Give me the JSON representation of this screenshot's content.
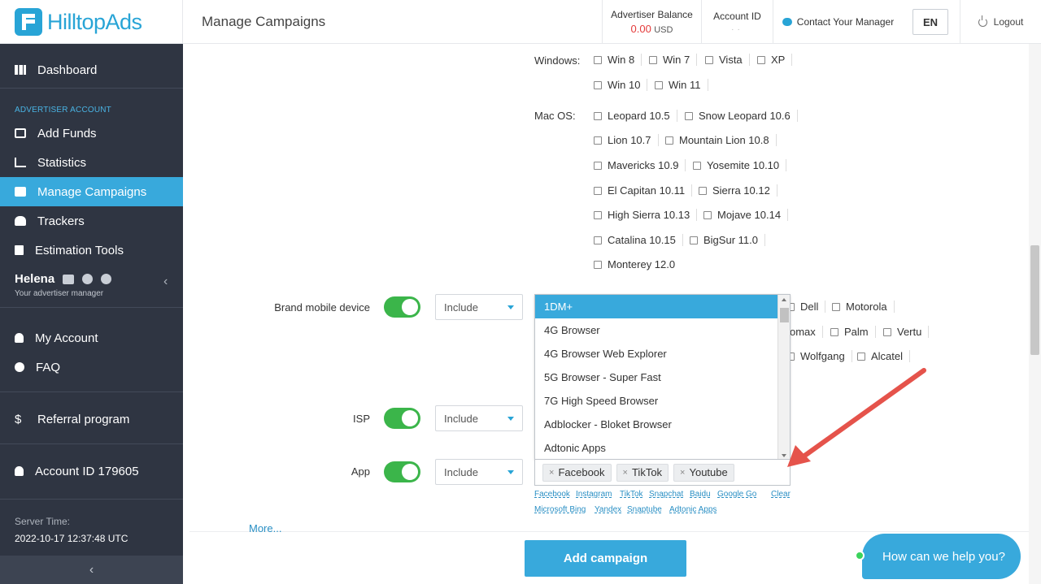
{
  "header": {
    "logo": "HilltopAds",
    "page_title": "Manage Campaigns",
    "balance_label": "Advertiser Balance",
    "balance_value": "0.00",
    "balance_currency": "USD",
    "account_id_label": "Account ID",
    "contact_label": "Contact Your Manager",
    "language": "EN",
    "logout_label": "Logout"
  },
  "sidebar": {
    "dashboard": "Dashboard",
    "section_label": "ADVERTISER ACCOUNT",
    "items": [
      "Add Funds",
      "Statistics",
      "Manage Campaigns",
      "Trackers",
      "Estimation Tools"
    ],
    "active_item": "Manage Campaigns",
    "manager_name": "Helena",
    "manager_role": "Your advertiser manager",
    "my_account": "My Account",
    "faq": "FAQ",
    "referral": "Referral program",
    "account_id": "Account ID 179605",
    "server_time_label": "Server Time:",
    "server_time": "2022-10-17 12:37:48 UTC"
  },
  "os": {
    "windows_label": "Windows:",
    "windows": [
      "Win 8",
      "Win 7",
      "Vista",
      "XP",
      "Win 10",
      "Win 11"
    ],
    "mac_label": "Mac OS:",
    "mac": [
      "Leopard 10.5",
      "Snow Leopard 10.6",
      "Lion 10.7",
      "Mountain Lion 10.8",
      "Mavericks 10.9",
      "Yosemite 10.10",
      "El Capitan 10.11",
      "Sierra 10.12",
      "High Sierra 10.13",
      "Mojave 10.14",
      "Catalina 10.15",
      "BigSur 11.0",
      "Monterey 12.0"
    ]
  },
  "brand": {
    "label": "Brand mobile device",
    "mode": "Include",
    "visible_brands": [
      "Dell",
      "Motorola",
      "omax",
      "Palm",
      "Vertu",
      "Wolfgang",
      "Alcatel"
    ]
  },
  "isp": {
    "label": "ISP",
    "mode": "Include"
  },
  "app": {
    "label": "App",
    "mode": "Include",
    "dropdown_options": [
      "1DM+",
      "4G Browser",
      "4G Browser Web Explorer",
      "5G Browser - Super Fast",
      "7G High Speed Browser",
      "Adblocker - Bloket Browser",
      "Adtonic Apps"
    ],
    "selected_option": "1DM+",
    "tags": [
      "Facebook",
      "TikTok",
      "Youtube"
    ],
    "quick_links_row1": [
      "Facebook",
      "Instagram",
      "TikTok",
      "Snapchat",
      "Baidu",
      "Google Go"
    ],
    "quick_links_row2": [
      "Microsoft Bing",
      "Yandex",
      "Snaptube",
      "Adtonic Apps"
    ],
    "clear_label": "Clear"
  },
  "more_label": "More...",
  "add_campaign_label": "Add campaign",
  "chat_label": "How can we help you?",
  "colors": {
    "accent": "#38a9dc",
    "sidebar": "#2f3542",
    "toggle_on": "#3bb54a",
    "balance": "#e43a3a",
    "arrow": "#e5534b"
  }
}
